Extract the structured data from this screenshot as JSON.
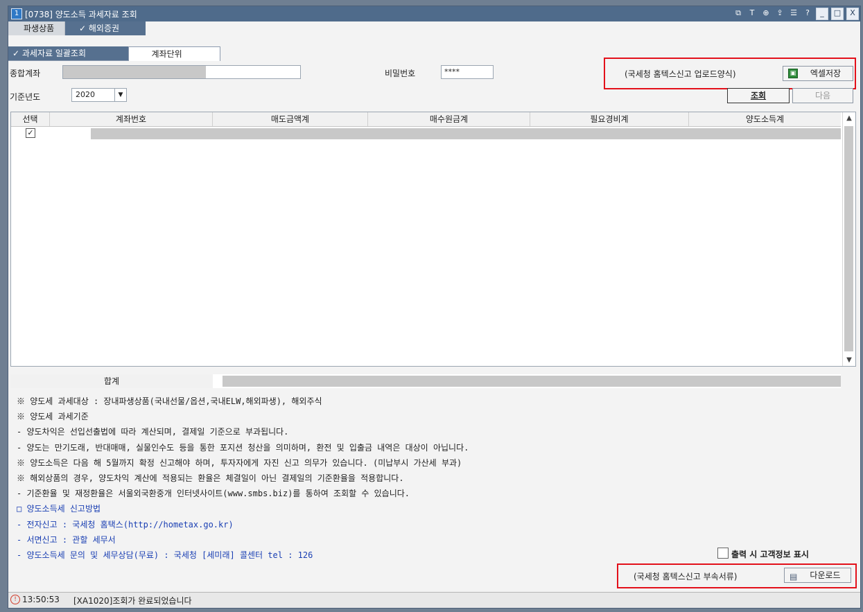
{
  "window": {
    "number": "1",
    "title": "[0738] 양도소득 과세자료 조회",
    "controls": [
      "new-window-icon",
      "text-icon",
      "copy-icon",
      "link-icon",
      "list-icon",
      "help-icon",
      "minimize-icon",
      "maximize-icon",
      "close-icon"
    ],
    "control_glyphs": [
      "⧉",
      "T",
      "⊕",
      "⇪",
      "☰",
      "?",
      "_",
      "□",
      "X"
    ]
  },
  "tabs": {
    "derivatives": "파생상품",
    "overseas": "✓ 해외증권"
  },
  "subtabs": {
    "bulk": "✓ 과세자료 일괄조회",
    "account": "계좌단위"
  },
  "form": {
    "account_label": "종합계좌",
    "password_label": "비밀번호",
    "password_value": "****",
    "year_label": "기준년도",
    "year_value": "2020",
    "hometax_upload": "(국세청 홈텍스신고 업로드양식)",
    "excel_save": "엑셀저장",
    "search": "조회",
    "next": "다음"
  },
  "grid": {
    "columns": [
      "선택",
      "계좌번호",
      "매도금액계",
      "매수원금계",
      "필요경비계",
      "양도소득계"
    ],
    "row_checked": true,
    "sum_label": "합계"
  },
  "notes": [
    "※ 양도세 과세대상 : 장내파생상품(국내선물/옵션,국내ELW,해외파생), 해외주식",
    "※ 양도세 과세기준",
    " - 양도차익은 선입선출법에 따라 계산되며, 결제일 기준으로 부과됩니다.",
    " - 양도는 만기도래, 반대매매, 실물인수도 등을 통한 포지션 청산을 의미하며, 환전 및 입출금 내역은 대상이 아닙니다.",
    "※ 양도소득은 다음 해 5월까지 확정 신고해야 하며, 투자자에게 자진 신고 의무가 있습니다. (미납부시 가산세 부과)",
    "※ 해외상품의 경우, 양도차익 계산에 적용되는 환율은 체결일이 아닌 결제일의 기준환율을 적용합니다.",
    " - 기준환율 및 재정환율은 서울외국환중개 인터넷사이트(www.smbs.biz)를 통하여 조회할 수 있습니다."
  ],
  "blue_notes": [
    "□ 양도소득세 신고방법",
    " - 전자신고 : 국세청 홈택스(http://hometax.go.kr)",
    " - 서면신고 : 관할 세무서",
    " - 양도소득세 문의 및 세무상담(무료) : 국세청 [세미래] 콜센터 tel : 126"
  ],
  "print_option": "출력 시 고객정보 표시",
  "hometax_attach": "(국세청 홈텍스신고 부속서류)",
  "download": "다운로드",
  "status": {
    "time": "13:50:53",
    "message": "[XA1020]조회가 완료되었습니다"
  },
  "colors": {
    "title_bar": "#4f6b8b",
    "tab_active": "#56708f",
    "highlight": "#e3101a",
    "note_blue": "#1a3fb3"
  }
}
